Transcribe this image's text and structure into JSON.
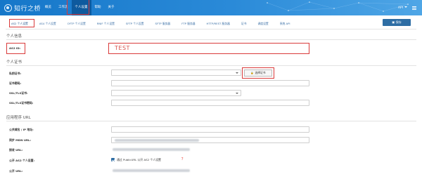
{
  "app": {
    "logo_text": "知行之桥"
  },
  "nav": {
    "items": [
      {
        "label": "概览"
      },
      {
        "label": "工作流"
      },
      {
        "label": "个人设置"
      },
      {
        "label": "帮助"
      },
      {
        "label": "关于"
      }
    ]
  },
  "user": {
    "name": "API"
  },
  "tabs": [
    {
      "label": "AS2 个人设置"
    },
    {
      "label": "AS4 个人设置"
    },
    {
      "label": "OFTP 个人设置"
    },
    {
      "label": "RNIF 个人设置"
    },
    {
      "label": "SFTP 个人设置"
    },
    {
      "label": "SFTP 服务器"
    },
    {
      "label": "FTP 服务器"
    },
    {
      "label": "HTTP/REST 服务器"
    },
    {
      "label": "证书"
    },
    {
      "label": "调度设置"
    },
    {
      "label": "系统 API"
    }
  ],
  "toolbar": {
    "save_label": "保存"
  },
  "personal_info": {
    "title": "个人信息",
    "as2_id_label": "AS2 ID:",
    "as2_id_value": "TEST"
  },
  "certificates": {
    "title": "个人证书",
    "private_cert_label": "私钥证书:",
    "cert_password_label": "证书密码:",
    "tls_cert_label": "SSL/TLS证书:",
    "tls_password_label": "SSL/TLS证书密码:",
    "select_cert_button": "选择证书"
  },
  "app_url": {
    "title": "应用程序 URL",
    "public_domain_label": "公共域名 / IP 地址:",
    "mdn_url_label": "同步 MDN URL:",
    "receive_url_label": "接收 URL:",
    "public_profile_label": "公开 AS2 个人设置:",
    "public_profile_check_label": "通过 PublicURL 公开 AS2 个人设置",
    "public_url_label": "公开 URL:"
  },
  "colors": {
    "nav_bg": "#1677c9",
    "primary_button": "#2e6da4",
    "highlight": "#d93a3a",
    "value_text": "#d9534f"
  }
}
